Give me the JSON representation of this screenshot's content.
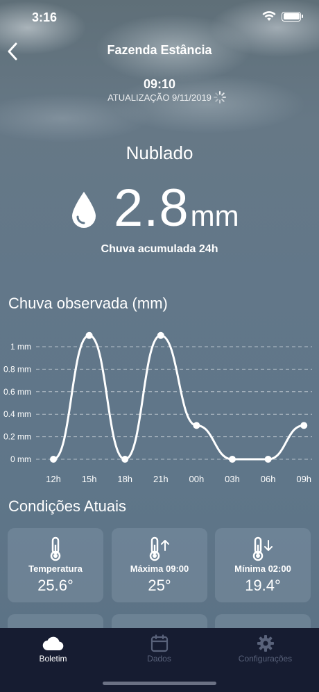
{
  "status_bar": {
    "time": "3:16"
  },
  "nav": {
    "title": "Fazenda Estância"
  },
  "update": {
    "time": "09:10",
    "line": "ATUALIZAÇÃO 9/11/2019"
  },
  "summary": {
    "condition": "Nublado",
    "rain_value": "2.8",
    "rain_unit": "mm",
    "rain_caption": "Chuva acumulada 24h",
    "drop_icon": "water-drop-icon"
  },
  "chart_section": {
    "title": "Chuva observada (mm)"
  },
  "chart_data": {
    "type": "line",
    "title": "Chuva observada (mm)",
    "categories": [
      "12h",
      "15h",
      "18h",
      "21h",
      "00h",
      "03h",
      "06h",
      "09h"
    ],
    "values": [
      0,
      1.1,
      0,
      1.1,
      0.3,
      0,
      0,
      0.3
    ],
    "y_ticks": [
      "0 mm",
      "0.2 mm",
      "0.4 mm",
      "0.6 mm",
      "0.8 mm",
      "1 mm"
    ],
    "ylim": [
      0,
      1.1
    ],
    "grid": true,
    "curve": "smooth",
    "color": "#ffffff"
  },
  "conditions": {
    "title": "Condições Atuais",
    "cards": [
      {
        "icon": "thermometer-icon",
        "label": "Temperatura",
        "value": "25.6°"
      },
      {
        "icon": "thermometer-up-icon",
        "label": "Máxima 09:00",
        "value": "25°"
      },
      {
        "icon": "thermometer-down-icon",
        "label": "Mínima 02:00",
        "value": "19.4°"
      }
    ]
  },
  "tabbar": {
    "tabs": [
      {
        "label": "Boletim",
        "icon": "cloud-icon",
        "active": true
      },
      {
        "label": "Dados",
        "icon": "calendar-icon",
        "active": false
      },
      {
        "label": "Configurações",
        "icon": "gear-icon",
        "active": false
      }
    ]
  },
  "colors": {
    "tabbar_bg": "#161c31",
    "inactive_tab": "#59627a"
  }
}
